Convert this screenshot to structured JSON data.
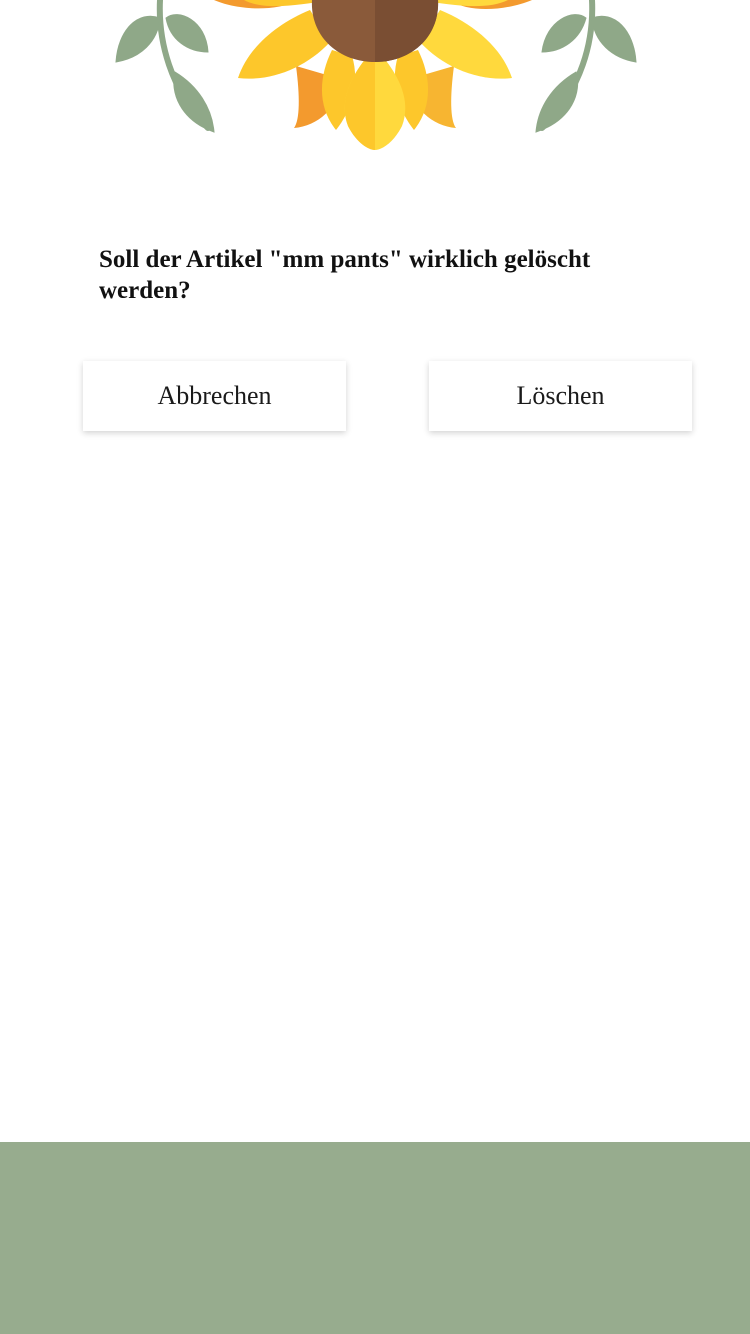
{
  "dialog": {
    "message": "Soll der Artikel \"mm pants\" wirklich gelöscht werden?",
    "cancel_label": "Abbrechen",
    "delete_label": "Löschen"
  },
  "colors": {
    "footer": "#97ac8e",
    "leaf": "#8fa888",
    "petal_orange": "#f39a2e",
    "petal_yellow": "#fdc72b",
    "petal_light": "#ffd93d",
    "sunflower_center": "#8a5a3a"
  },
  "icons": {
    "header": "sunflower-illustration"
  }
}
